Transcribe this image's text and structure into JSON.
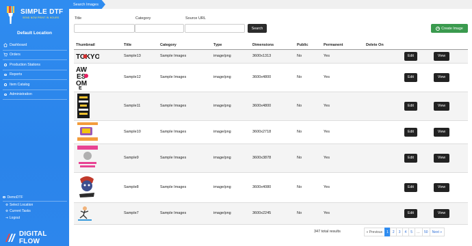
{
  "brand": {
    "name": "SIMPLE DTF",
    "tagline": "SEND NOW PRINT IN HOURS",
    "footer": "DIGITAL FLOW"
  },
  "sidebar": {
    "location": "Default Location",
    "items": [
      {
        "label": "Dashboard",
        "icon": "home-icon"
      },
      {
        "label": "Orders",
        "icon": "cart-icon"
      },
      {
        "label": "Production Stations",
        "icon": "dot-icon"
      },
      {
        "label": "Reports",
        "icon": "dot-icon"
      },
      {
        "label": "Item Catalog",
        "icon": "dot-icon"
      },
      {
        "label": "Administration",
        "icon": "dot-icon"
      }
    ],
    "user": {
      "name": "DemoDTF",
      "links": [
        {
          "label": "Select Location",
          "icon": "gear-icon"
        },
        {
          "label": "Current Tasks",
          "icon": "gear-icon"
        },
        {
          "label": "Logout",
          "icon": "logout-icon"
        }
      ]
    }
  },
  "breadcrumb": "Search Images",
  "filters": {
    "title": {
      "label": "Title",
      "value": ""
    },
    "category": {
      "label": "Category",
      "value": ""
    },
    "source_url": {
      "label": "Source URL",
      "value": ""
    },
    "search_label": "Search",
    "create_label": "Create Image"
  },
  "table": {
    "headers": [
      "Thumbnail",
      "Title",
      "Category",
      "Type",
      "Dimensions",
      "Public",
      "Permanent",
      "Delete On",
      "",
      ""
    ],
    "edit_label": "Edit",
    "view_label": "View",
    "rows": [
      {
        "title": "Sample13",
        "category": "Sample Images",
        "type": "image/png",
        "dimensions": "3600x1313",
        "public": "No",
        "permanent": "Yes",
        "delete_on": "",
        "thumb": "tokyo"
      },
      {
        "title": "Sample12",
        "category": "Sample Images",
        "type": "image/png",
        "dimensions": "3600x4800",
        "public": "No",
        "permanent": "Yes",
        "delete_on": "",
        "thumb": "awesome"
      },
      {
        "title": "Sample11",
        "category": "Sample Images",
        "type": "image/png",
        "dimensions": "3600x4800",
        "public": "No",
        "permanent": "Yes",
        "delete_on": "",
        "thumb": "poster"
      },
      {
        "title": "Sample10",
        "category": "Sample Images",
        "type": "image/png",
        "dimensions": "3600x2718",
        "public": "No",
        "permanent": "Yes",
        "delete_on": "",
        "thumb": "working"
      },
      {
        "title": "Sample9",
        "category": "Sample Images",
        "type": "image/png",
        "dimensions": "3600x3878",
        "public": "No",
        "permanent": "Yes",
        "delete_on": "",
        "thumb": "workout"
      },
      {
        "title": "Sample8",
        "category": "Sample Images",
        "type": "image/png",
        "dimensions": "3600x4080",
        "public": "No",
        "permanent": "Yes",
        "delete_on": "",
        "thumb": "character"
      },
      {
        "title": "Sample7",
        "category": "Sample Images",
        "type": "image/png",
        "dimensions": "3600x2245",
        "public": "No",
        "permanent": "Yes",
        "delete_on": "",
        "thumb": "runner"
      }
    ]
  },
  "pagination": {
    "total_text": "347 total results",
    "prev_label": "« Previous",
    "pages": [
      "1",
      "2",
      "3",
      "4",
      "5",
      "…",
      "50"
    ],
    "active_page": "1",
    "next_label": "Next »"
  },
  "colors": {
    "sidebar": "#2f8cf0",
    "create": "#3a9a4e",
    "button": "#222222"
  }
}
